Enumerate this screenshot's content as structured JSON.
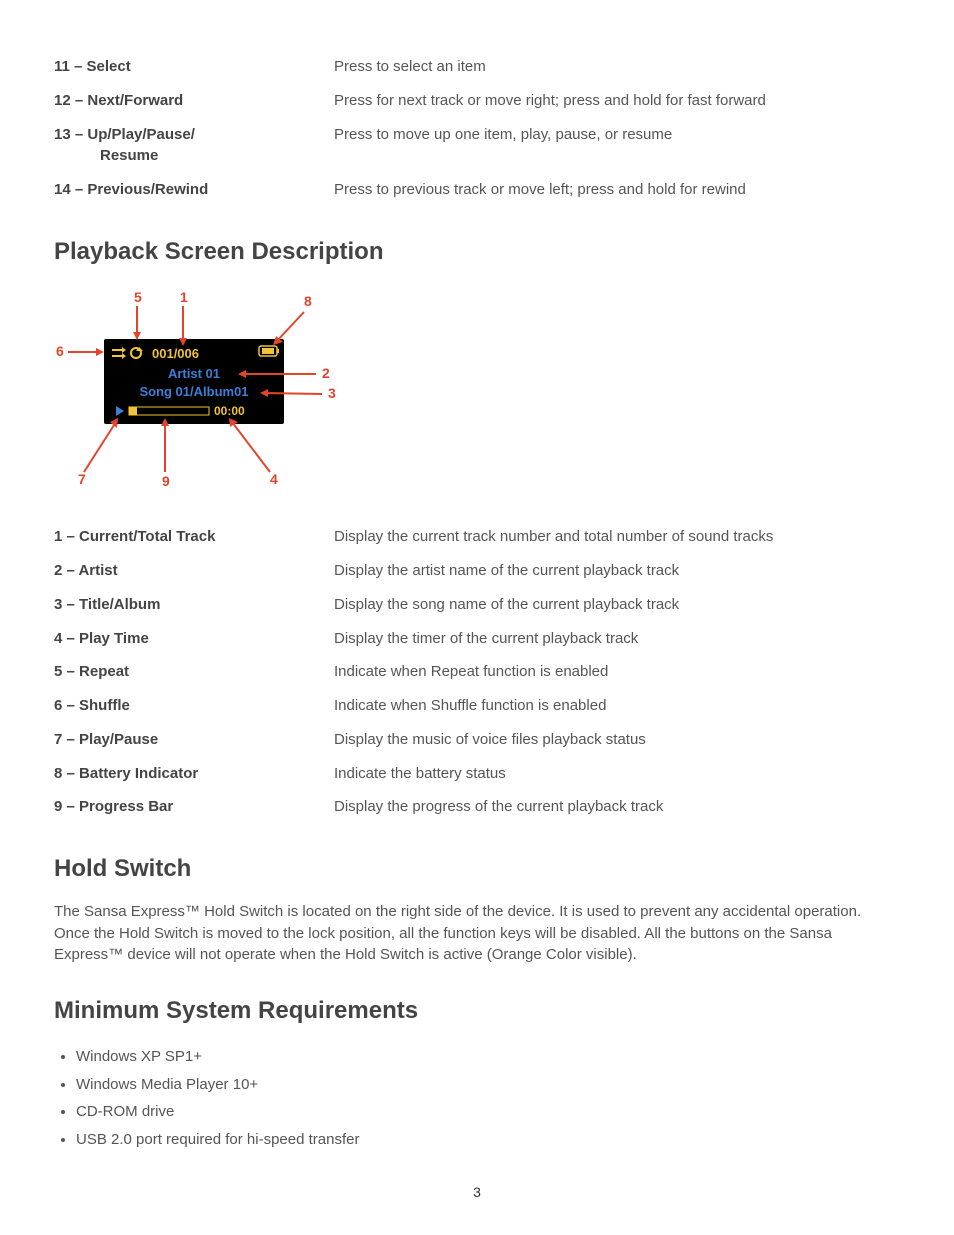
{
  "controls": [
    {
      "term": "11 – Select",
      "desc": "Press to select an item"
    },
    {
      "term": "12 – Next/Forward",
      "desc": "Press for next track or move right; press and hold for fast forward"
    },
    {
      "term": "13 – Up/Play/Pause/",
      "term2": "Resume",
      "desc": "Press to move up one item, play, pause, or resume"
    },
    {
      "term": "14 – Previous/Rewind",
      "desc": "Press to previous track or move left; press and hold for rewind"
    }
  ],
  "heading_playback": "Playback Screen Description",
  "diagram": {
    "callouts": {
      "1": "1",
      "2": "2",
      "3": "3",
      "4": "4",
      "5": "5",
      "6": "6",
      "7": "7",
      "8": "8",
      "9": "9"
    },
    "track_counter": "001/006",
    "artist": "Artist 01",
    "title": "Song 01/Album01",
    "time": "00:00"
  },
  "playback_items": [
    {
      "term": "1 – Current/Total Track",
      "desc": "Display the current track number and total number of sound tracks"
    },
    {
      "term": "2 – Artist",
      "desc": "Display the artist name of the current playback track"
    },
    {
      "term": "3 – Title/Album",
      "desc": "Display the song name of the current playback track"
    },
    {
      "term": "4 – Play Time",
      "desc": "Display the timer of the current playback track"
    },
    {
      "term": "5 – Repeat",
      "desc": "Indicate when Repeat function is enabled"
    },
    {
      "term": "6 – Shuffle",
      "desc": "Indicate when Shuffle function is enabled"
    },
    {
      "term": "7 – Play/Pause",
      "desc": "Display the music of voice files playback status"
    },
    {
      "term": "8 – Battery Indicator",
      "desc": "Indicate the battery status"
    },
    {
      "term": "9 – Progress Bar",
      "desc": "Display the progress of the current playback track"
    }
  ],
  "heading_hold": "Hold Switch",
  "hold_text": "The Sansa Express™ Hold Switch is located on the right side of the device.  It is used to prevent any accidental operation.  Once the Hold Switch is moved to the lock position, all the function keys will be disabled.  All the buttons on the Sansa Express™ device will not operate when the Hold Switch is active (Orange Color visible).",
  "heading_req": "Minimum System Requirements",
  "requirements": [
    "Windows XP SP1+",
    "Windows Media Player 10+",
    "CD-ROM drive",
    "USB 2.0 port required for hi-speed transfer"
  ],
  "page_number": "3"
}
